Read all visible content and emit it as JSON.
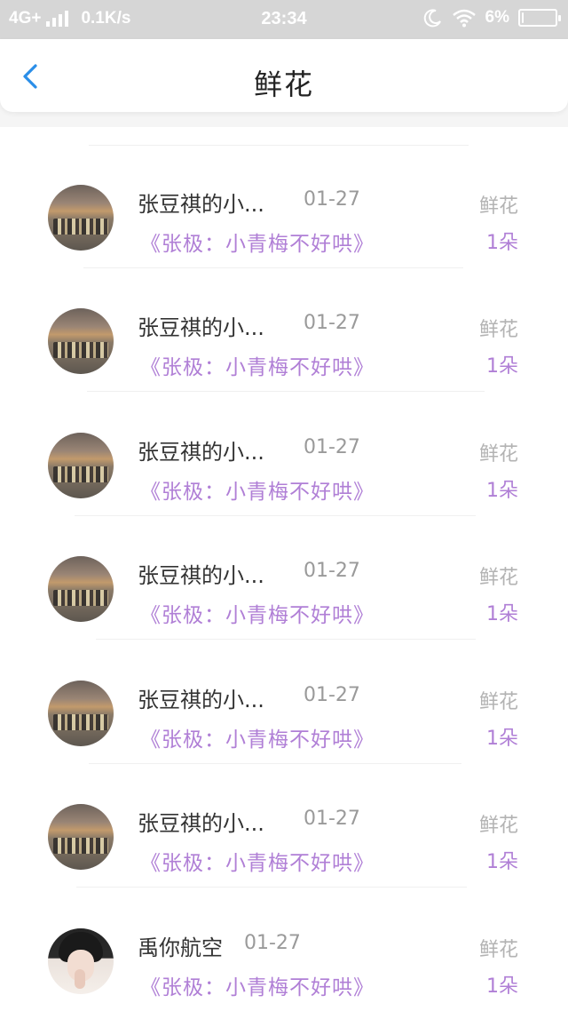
{
  "status_bar": {
    "network": "4G+",
    "speed": "0.1K/s",
    "time": "23:34",
    "battery_percent": "6%",
    "battery_level": 0.06,
    "icons": [
      "signal-icon",
      "moon-icon",
      "wifi-icon",
      "battery-icon"
    ]
  },
  "nav": {
    "title": "鲜花",
    "back_icon": "chevron-left-icon",
    "accent_color": "#2a8ee8"
  },
  "colors": {
    "accent_purple": "#b07fd6",
    "muted_text": "#9a9a9a"
  },
  "items": [
    {
      "name": "张豆祺的小...",
      "date": "01-27",
      "subtitle": "《张极：小青梅不好哄》",
      "gift": "鲜花",
      "count": "1朵",
      "avatar": "group-photo-avatar"
    },
    {
      "name": "张豆祺的小...",
      "date": "01-27",
      "subtitle": "《张极：小青梅不好哄》",
      "gift": "鲜花",
      "count": "1朵",
      "avatar": "group-photo-avatar"
    },
    {
      "name": "张豆祺的小...",
      "date": "01-27",
      "subtitle": "《张极：小青梅不好哄》",
      "gift": "鲜花",
      "count": "1朵",
      "avatar": "group-photo-avatar"
    },
    {
      "name": "张豆祺的小...",
      "date": "01-27",
      "subtitle": "《张极：小青梅不好哄》",
      "gift": "鲜花",
      "count": "1朵",
      "avatar": "group-photo-avatar"
    },
    {
      "name": "张豆祺的小...",
      "date": "01-27",
      "subtitle": "《张极：小青梅不好哄》",
      "gift": "鲜花",
      "count": "1朵",
      "avatar": "group-photo-avatar"
    },
    {
      "name": "张豆祺的小...",
      "date": "01-27",
      "subtitle": "《张极：小青梅不好哄》",
      "gift": "鲜花",
      "count": "1朵",
      "avatar": "group-photo-avatar"
    },
    {
      "name": "禹你航空",
      "date": "01-27",
      "subtitle": "《张极：小青梅不好哄》",
      "gift": "鲜花",
      "count": "1朵",
      "avatar": "portrait-avatar"
    }
  ]
}
